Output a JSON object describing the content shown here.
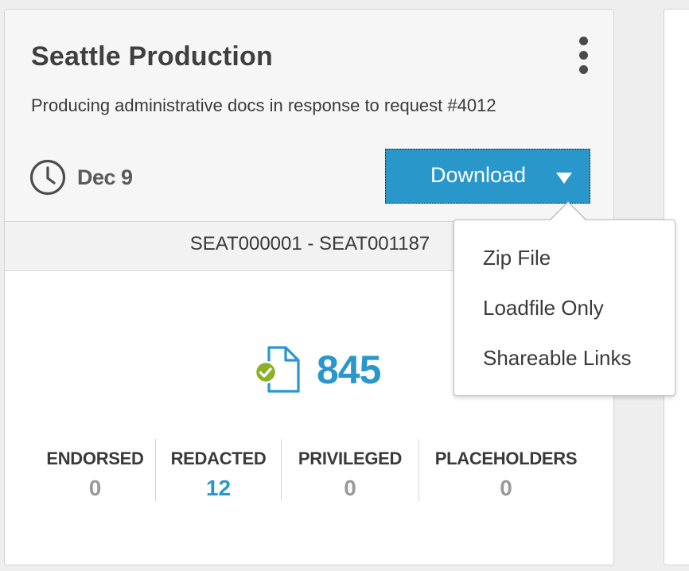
{
  "card": {
    "title": "Seattle Production",
    "description": "Producing administrative docs in response to request #4012",
    "date": "Dec 9",
    "download_label": "Download",
    "bates_range": "SEAT000001 - SEAT001187",
    "document_count": "845",
    "stats": [
      {
        "label": "ENDORSED",
        "value": "0"
      },
      {
        "label": "REDACTED",
        "value": "12"
      },
      {
        "label": "PRIVILEGED",
        "value": "0"
      },
      {
        "label": "PLACEHOLDERS",
        "value": "0"
      }
    ]
  },
  "download_menu": {
    "items": [
      "Zip File",
      "Loadfile Only",
      "Shareable Links"
    ]
  },
  "colors": {
    "accent": "#2a97cb",
    "check_green": "#8cb028",
    "muted_value": "#9a9a9a"
  }
}
